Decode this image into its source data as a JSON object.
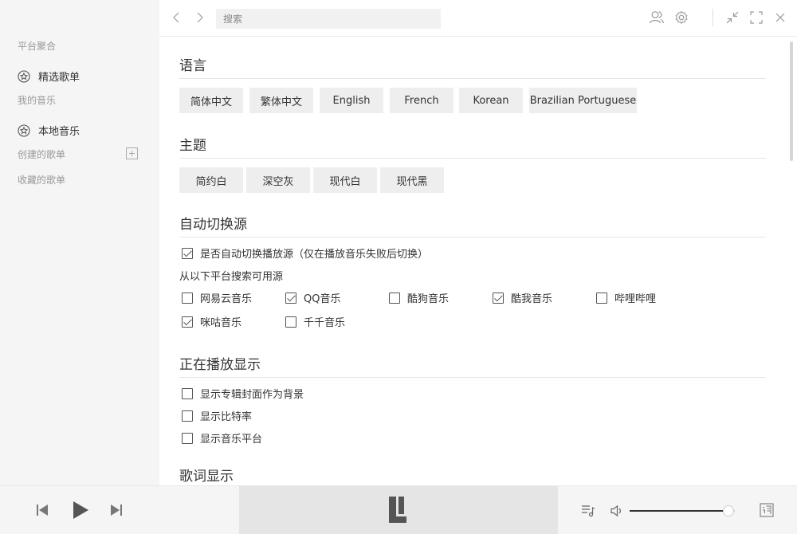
{
  "sidebar": {
    "platform_title": "平台聚合",
    "featured_label": "精选歌单",
    "my_music_title": "我的音乐",
    "local_label": "本地音乐",
    "created_title": "创建的歌单",
    "collected_title": "收藏的歌单"
  },
  "topbar": {
    "search_placeholder": "搜索"
  },
  "language": {
    "title": "语言",
    "options": [
      "简体中文",
      "繁体中文",
      "English",
      "French",
      "Korean",
      "Brazilian Portuguese"
    ]
  },
  "theme": {
    "title": "主题",
    "options": [
      "简约白",
      "深空灰",
      "现代白",
      "现代黑"
    ]
  },
  "auto_switch": {
    "title": "自动切换源",
    "toggle_label": "是否自动切换播放源（仅在播放音乐失败后切换）",
    "toggle_checked": true,
    "sources_label": "从以下平台搜索可用源",
    "sources": [
      {
        "label": "网易云音乐",
        "checked": false
      },
      {
        "label": "QQ音乐",
        "checked": true
      },
      {
        "label": "酷狗音乐",
        "checked": false
      },
      {
        "label": "酷我音乐",
        "checked": true
      },
      {
        "label": "哔哩哔哩",
        "checked": false
      },
      {
        "label": "咪咕音乐",
        "checked": true
      },
      {
        "label": "千千音乐",
        "checked": false
      }
    ]
  },
  "now_playing": {
    "title": "正在播放显示",
    "options": [
      {
        "label": "显示专辑封面作为背景",
        "checked": false
      },
      {
        "label": "显示比特率",
        "checked": false
      },
      {
        "label": "显示音乐平台",
        "checked": false
      }
    ]
  },
  "lyrics": {
    "title": "歌词显示"
  },
  "player": {
    "volume_level": 0.94
  },
  "colors": {
    "sidebar_bg": "#f5f5f5",
    "chip_bg": "#eeeeee",
    "player_center_bg": "#e5e5e5"
  }
}
